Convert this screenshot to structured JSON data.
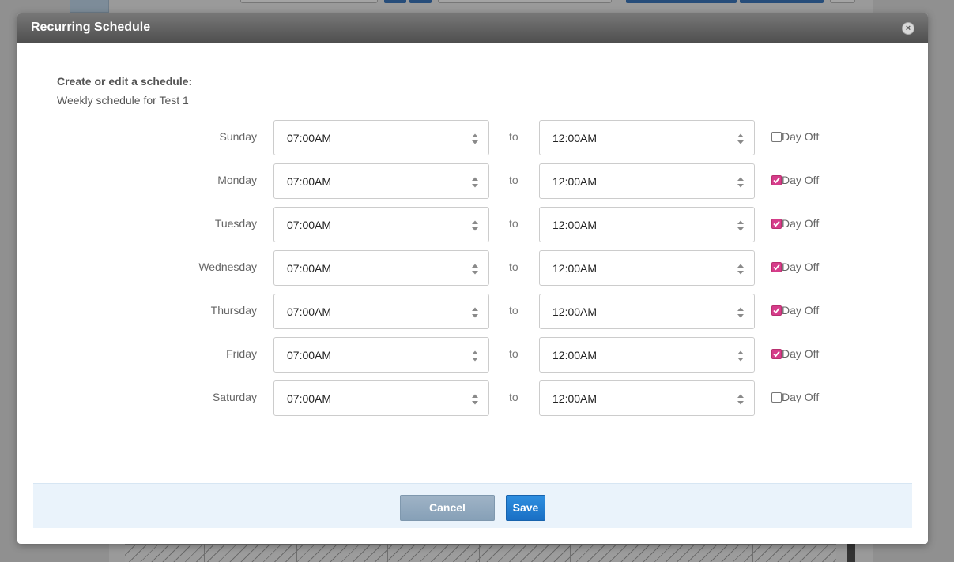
{
  "dialog": {
    "title": "Recurring Schedule",
    "heading": "Create or edit a schedule:",
    "subheading": "Weekly schedule for Test 1",
    "to_label": "to",
    "day_off_label": "Day Off"
  },
  "schedule": [
    {
      "day": "Sunday",
      "start": "07:00AM",
      "end": "12:00AM",
      "day_off": false
    },
    {
      "day": "Monday",
      "start": "07:00AM",
      "end": "12:00AM",
      "day_off": true
    },
    {
      "day": "Tuesday",
      "start": "07:00AM",
      "end": "12:00AM",
      "day_off": true
    },
    {
      "day": "Wednesday",
      "start": "07:00AM",
      "end": "12:00AM",
      "day_off": true
    },
    {
      "day": "Thursday",
      "start": "07:00AM",
      "end": "12:00AM",
      "day_off": true
    },
    {
      "day": "Friday",
      "start": "07:00AM",
      "end": "12:00AM",
      "day_off": true
    },
    {
      "day": "Saturday",
      "start": "07:00AM",
      "end": "12:00AM",
      "day_off": false
    }
  ],
  "footer": {
    "cancel_label": "Cancel",
    "save_label": "Save"
  },
  "colors": {
    "checkbox_checked": "#d63c8a",
    "save_button": "#1a6fc4",
    "cancel_button": "#86a0b7",
    "header": "#5a5a5a"
  },
  "icons": {
    "close": "close-icon",
    "select_arrows": "sort-arrows-icon",
    "check": "check-icon"
  }
}
